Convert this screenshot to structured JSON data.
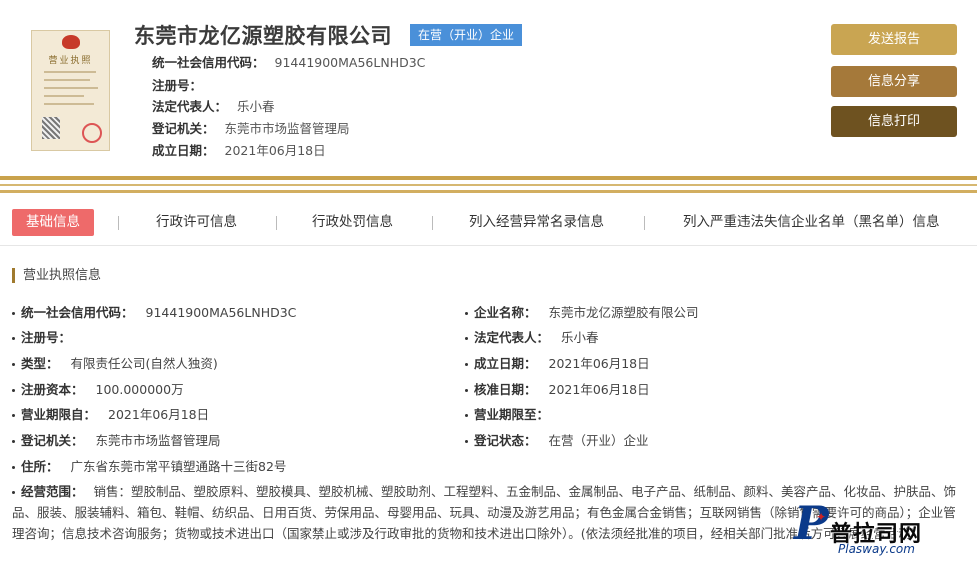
{
  "header": {
    "company_name": "东莞市龙亿源塑胶有限公司",
    "status_badge": "在营（开业）企业",
    "license_thumb_title": "营业执照",
    "rows": [
      {
        "label": "统一社会信用代码：",
        "value": "91441900MA56LNHD3C"
      },
      {
        "label": "注册号：",
        "value": ""
      },
      {
        "label": "法定代表人：",
        "value": "乐小春"
      },
      {
        "label": "登记机关：",
        "value": "东莞市市场监督管理局"
      },
      {
        "label": "成立日期：",
        "value": "2021年06月18日"
      }
    ],
    "buttons": {
      "report": "发送报告",
      "share": "信息分享",
      "print": "信息打印"
    }
  },
  "tabs": [
    {
      "label": "基础信息",
      "active": true
    },
    {
      "label": "行政许可信息",
      "active": false
    },
    {
      "label": "行政处罚信息",
      "active": false
    },
    {
      "label": "列入经营异常名录信息",
      "active": false
    },
    {
      "label": "列入严重违法失信企业名单（黑名单）信息",
      "active": false
    }
  ],
  "section": {
    "title": "营业执照信息",
    "left": [
      {
        "label": "统一社会信用代码：",
        "value": "91441900MA56LNHD3C"
      },
      {
        "label": "注册号：",
        "value": ""
      },
      {
        "label": "类型：",
        "value": "有限责任公司(自然人独资)"
      },
      {
        "label": "注册资本：",
        "value": "100.000000万"
      },
      {
        "label": "营业期限自：",
        "value": "2021年06月18日"
      },
      {
        "label": "登记机关：",
        "value": "东莞市市场监督管理局"
      },
      {
        "label": "住所：",
        "value": "广东省东莞市常平镇塑通路十三街82号"
      }
    ],
    "right": [
      {
        "label": "企业名称：",
        "value": "东莞市龙亿源塑胶有限公司"
      },
      {
        "label": "法定代表人：",
        "value": "乐小春"
      },
      {
        "label": "成立日期：",
        "value": "2021年06月18日"
      },
      {
        "label": "核准日期：",
        "value": "2021年06月18日"
      },
      {
        "label": "营业期限至：",
        "value": ""
      },
      {
        "label": "登记状态：",
        "value": "在营（开业）企业"
      }
    ],
    "scope_label": "经营范围：",
    "scope_text": "销售：塑胶制品、塑胶原料、塑胶模具、塑胶机械、塑胶助剂、工程塑料、五金制品、金属制品、电子产品、纸制品、颜料、美容产品、化妆品、护肤品、饰品、服装、服装辅料、箱包、鞋帽、纺织品、日用百货、劳保用品、母婴用品、玩具、动漫及游艺用品；有色金属合金销售；互联网销售（除销售需要许可的商品）；企业管理咨询；信息技术咨询服务；货物或技术进出口（国家禁止或涉及行政审批的货物和技术进出口除外）。(依法须经批准的项目，经相关部门批准后方可开展经营活动)"
  },
  "watermark": {
    "letter": "P",
    "cn": "普拉司网",
    "en": "Plasway.com"
  },
  "colors": {
    "gold": "#c9a24c",
    "active_tab": "#ee6a6a",
    "badge": "#4a90d9"
  }
}
